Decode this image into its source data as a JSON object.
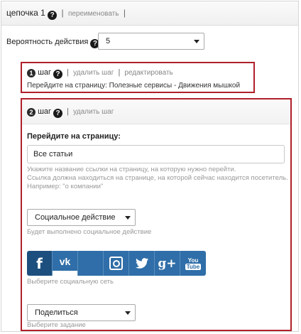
{
  "chain": {
    "title": "цепочка 1",
    "rename_link": "переименовать",
    "separator": "|"
  },
  "probability": {
    "label": "Вероятность действия",
    "value": "5"
  },
  "step1": {
    "number": "1",
    "label": "шаг",
    "delete_link": "удалить шаг",
    "edit_link": "редактировать",
    "description": "Перейдите на страницу: Полезные сервисы - Движения мышкой"
  },
  "step2": {
    "number": "2",
    "label": "шаг",
    "delete_link": "удалить шаг",
    "field_label": "Перейдите на страницу:",
    "field_value": "Все статьи",
    "hint_lines": [
      "Укажите название ссылки на страницу, на которую нужно перейти.",
      "Ссылка должна находиться на странице, на которой сейчас находится посетитель.",
      "Например: \"о компании\""
    ],
    "action_select": "Социальное действие",
    "action_hint": "Будет выполнено социальное действие",
    "network_hint": "Выберите социальную сеть",
    "task_select": "Поделиться",
    "task_hint": "Выберите задание"
  },
  "social_networks": [
    {
      "name": "facebook",
      "glyph": "f",
      "state": "active"
    },
    {
      "name": "vk",
      "glyph": "vk",
      "state": "selected"
    },
    {
      "name": "blank",
      "glyph": "",
      "state": "normal"
    },
    {
      "name": "instagram",
      "glyph": "ig",
      "state": "normal"
    },
    {
      "name": "twitter",
      "glyph": "tw",
      "state": "normal"
    },
    {
      "name": "google-plus",
      "glyph": "g+",
      "state": "normal"
    },
    {
      "name": "youtube",
      "glyph": "You Tube",
      "state": "normal"
    }
  ],
  "colors": {
    "accent_border": "#b0202a",
    "social_blue": "#2f6ea8",
    "social_active": "#1d4f7e"
  }
}
